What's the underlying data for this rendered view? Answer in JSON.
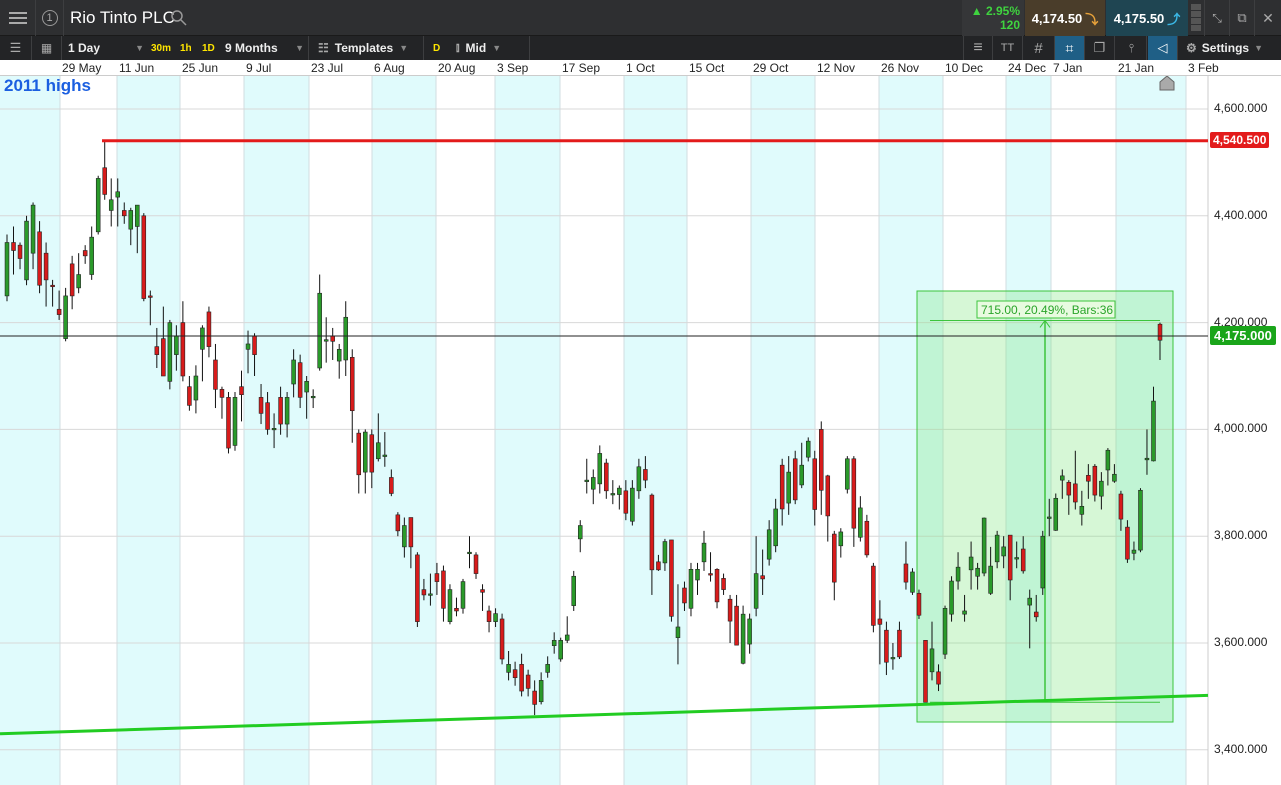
{
  "header": {
    "title": "Rio Tinto PLC",
    "change_pct": "2.95%",
    "change_abs": "120",
    "sell_price": "4,174.50",
    "buy_price": "4,175.50"
  },
  "toolbar": {
    "interval": "1 Day",
    "q30m": "30m",
    "q1h": "1h",
    "q1d": "1D",
    "range": "9 Months",
    "templates": "Templates",
    "d": "D",
    "price_type": "Mid",
    "settings": "Settings",
    "circle_num": "1"
  },
  "chart_annotation": "2011 highs",
  "date_labels": [
    "29 May",
    "11 Jun",
    "25 Jun",
    "9 Jul",
    "23 Jul",
    "6 Aug",
    "20 Aug",
    "3 Sep",
    "17 Sep",
    "1 Oct",
    "15 Oct",
    "29 Oct",
    "12 Nov",
    "26 Nov",
    "10 Dec",
    "24 Dec",
    "7 Jan",
    "21 Jan",
    "3 Feb"
  ],
  "price_labels": [
    "4,600.000",
    "4,400.000",
    "4,200.000",
    "4,000.000",
    "3,800.000",
    "3,600.000",
    "3,400.000"
  ],
  "resistance_label": "4,540.500",
  "current_label": "4,175.000",
  "measure_label": "715.00, 20.49%, Bars:36",
  "colors": {
    "up": "#2a9a2a",
    "down": "#d81b1b",
    "resistance": "#e31b1b",
    "trend": "#22cc22",
    "current": "#1aa51a",
    "band": "#e0fbfc"
  },
  "chart_data": {
    "type": "candlestick",
    "ylim": [
      3380,
      4640
    ],
    "yticks": [
      4600,
      4400,
      4200,
      4000,
      3800,
      3600,
      3400
    ],
    "resistance": 4540.5,
    "current": 4175,
    "trendline": [
      3430,
      3502
    ],
    "measure": {
      "from": 3489,
      "to": 4204,
      "change": 715.0,
      "pct": 20.49,
      "bars": 36
    },
    "candles": [
      [
        4250,
        4365,
        4240,
        4350
      ],
      [
        4350,
        4380,
        4290,
        4335
      ],
      [
        4345,
        4350,
        4300,
        4320
      ],
      [
        4280,
        4400,
        4270,
        4390
      ],
      [
        4330,
        4425,
        4300,
        4420
      ],
      [
        4370,
        4390,
        4255,
        4270
      ],
      [
        4330,
        4350,
        4230,
        4280
      ],
      [
        4270,
        4280,
        4230,
        4268
      ],
      [
        4225,
        4260,
        4205,
        4215
      ],
      [
        4170,
        4265,
        4165,
        4250
      ],
      [
        4310,
        4325,
        4225,
        4250
      ],
      [
        4265,
        4330,
        4255,
        4290
      ],
      [
        4335,
        4345,
        4310,
        4325
      ],
      [
        4290,
        4380,
        4280,
        4360
      ],
      [
        4370,
        4475,
        4365,
        4470
      ],
      [
        4490,
        4540,
        4430,
        4440
      ],
      [
        4410,
        4470,
        4380,
        4430
      ],
      [
        4435,
        4470,
        4380,
        4445
      ],
      [
        4410,
        4425,
        4385,
        4400
      ],
      [
        4375,
        4415,
        4345,
        4410
      ],
      [
        4380,
        4420,
        4330,
        4420
      ],
      [
        4400,
        4405,
        4240,
        4245
      ],
      [
        4250,
        4260,
        4195,
        4248
      ],
      [
        4155,
        4190,
        4115,
        4140
      ],
      [
        4170,
        4230,
        4100,
        4100
      ],
      [
        4090,
        4205,
        4075,
        4200
      ],
      [
        4140,
        4195,
        4110,
        4175
      ],
      [
        4200,
        4240,
        4090,
        4100
      ],
      [
        4080,
        4100,
        4035,
        4045
      ],
      [
        4055,
        4120,
        4030,
        4100
      ],
      [
        4150,
        4195,
        4090,
        4190
      ],
      [
        4220,
        4230,
        4135,
        4155
      ],
      [
        4130,
        4160,
        4040,
        4075
      ],
      [
        4075,
        4080,
        4020,
        4060
      ],
      [
        4060,
        4070,
        3955,
        3965
      ],
      [
        3970,
        4070,
        3960,
        4060
      ],
      [
        4080,
        4110,
        4015,
        4065
      ],
      [
        4150,
        4185,
        4105,
        4160
      ],
      [
        4175,
        4180,
        4100,
        4140
      ],
      [
        4060,
        4085,
        4010,
        4030
      ],
      [
        4050,
        4070,
        3990,
        4000
      ],
      [
        4000,
        4030,
        3965,
        4002
      ],
      [
        4060,
        4080,
        3990,
        4010
      ],
      [
        4010,
        4070,
        3985,
        4060
      ],
      [
        4085,
        4150,
        4060,
        4130
      ],
      [
        4125,
        4140,
        4040,
        4060
      ],
      [
        4070,
        4100,
        4020,
        4090
      ],
      [
        4060,
        4075,
        4040,
        4062
      ],
      [
        4115,
        4290,
        4110,
        4255
      ],
      [
        4167,
        4210,
        4125,
        4168
      ],
      [
        4175,
        4190,
        4130,
        4165
      ],
      [
        4128,
        4160,
        4095,
        4150
      ],
      [
        4130,
        4240,
        4100,
        4210
      ],
      [
        4135,
        4150,
        3975,
        4035
      ],
      [
        3993,
        4000,
        3880,
        3915
      ],
      [
        3920,
        4000,
        3880,
        3995
      ],
      [
        3990,
        4000,
        3890,
        3920
      ],
      [
        3945,
        4030,
        3940,
        3975
      ],
      [
        3950,
        3995,
        3930,
        3952
      ],
      [
        3910,
        3925,
        3875,
        3880
      ],
      [
        3840,
        3845,
        3800,
        3810
      ],
      [
        3780,
        3835,
        3760,
        3820
      ],
      [
        3835,
        3835,
        3740,
        3780
      ],
      [
        3765,
        3770,
        3630,
        3640
      ],
      [
        3700,
        3720,
        3680,
        3690
      ],
      [
        3690,
        3730,
        3670,
        3692
      ],
      [
        3730,
        3750,
        3690,
        3715
      ],
      [
        3735,
        3745,
        3640,
        3665
      ],
      [
        3640,
        3710,
        3635,
        3700
      ],
      [
        3665,
        3685,
        3650,
        3660
      ],
      [
        3665,
        3720,
        3655,
        3715
      ],
      [
        3770,
        3800,
        3740,
        3770
      ],
      [
        3765,
        3770,
        3720,
        3730
      ],
      [
        3700,
        3710,
        3660,
        3695
      ],
      [
        3660,
        3670,
        3620,
        3640
      ],
      [
        3640,
        3665,
        3630,
        3655
      ],
      [
        3645,
        3655,
        3560,
        3570
      ],
      [
        3545,
        3585,
        3530,
        3560
      ],
      [
        3550,
        3565,
        3520,
        3535
      ],
      [
        3560,
        3580,
        3500,
        3510
      ],
      [
        3540,
        3550,
        3500,
        3515
      ],
      [
        3510,
        3530,
        3465,
        3485
      ],
      [
        3490,
        3545,
        3485,
        3530
      ],
      [
        3545,
        3575,
        3535,
        3560
      ],
      [
        3595,
        3620,
        3580,
        3605
      ],
      [
        3570,
        3610,
        3565,
        3605
      ],
      [
        3605,
        3650,
        3600,
        3615
      ],
      [
        3670,
        3735,
        3660,
        3725
      ],
      [
        3795,
        3830,
        3770,
        3820
      ],
      [
        3905,
        3945,
        3880,
        3905
      ],
      [
        3888,
        3925,
        3860,
        3910
      ],
      [
        3898,
        3970,
        3880,
        3955
      ],
      [
        3937,
        3945,
        3870,
        3885
      ],
      [
        3880,
        3905,
        3860,
        3880
      ],
      [
        3878,
        3895,
        3850,
        3890
      ],
      [
        3885,
        3905,
        3830,
        3843
      ],
      [
        3828,
        3905,
        3820,
        3890
      ],
      [
        3885,
        3945,
        3870,
        3930
      ],
      [
        3925,
        3950,
        3890,
        3905
      ],
      [
        3877,
        3880,
        3690,
        3737
      ],
      [
        3752,
        3765,
        3735,
        3737
      ],
      [
        3750,
        3795,
        3735,
        3790
      ],
      [
        3793,
        3793,
        3640,
        3650
      ],
      [
        3610,
        3710,
        3560,
        3630
      ],
      [
        3703,
        3715,
        3660,
        3675
      ],
      [
        3665,
        3750,
        3650,
        3738
      ],
      [
        3718,
        3750,
        3690,
        3738
      ],
      [
        3752,
        3810,
        3735,
        3787
      ],
      [
        3730,
        3770,
        3715,
        3728
      ],
      [
        3738,
        3740,
        3665,
        3677
      ],
      [
        3721,
        3730,
        3690,
        3700
      ],
      [
        3682,
        3690,
        3600,
        3641
      ],
      [
        3669,
        3690,
        3600,
        3596
      ],
      [
        3562,
        3670,
        3560,
        3654
      ],
      [
        3598,
        3655,
        3580,
        3645
      ],
      [
        3665,
        3800,
        3650,
        3730
      ],
      [
        3726,
        3775,
        3690,
        3720
      ],
      [
        3757,
        3830,
        3745,
        3812
      ],
      [
        3782,
        3870,
        3770,
        3851
      ],
      [
        3933,
        3945,
        3820,
        3851
      ],
      [
        3862,
        3950,
        3840,
        3920
      ],
      [
        3945,
        3960,
        3860,
        3868
      ],
      [
        3896,
        3975,
        3890,
        3933
      ],
      [
        3948,
        3985,
        3940,
        3978
      ],
      [
        3945,
        3960,
        3820,
        3850
      ],
      [
        4000,
        4015,
        3840,
        3886
      ],
      [
        3913,
        3915,
        3790,
        3838
      ],
      [
        3804,
        3810,
        3680,
        3714
      ],
      [
        3782,
        3815,
        3760,
        3808
      ],
      [
        3888,
        3950,
        3880,
        3945
      ],
      [
        3945,
        3950,
        3780,
        3815
      ],
      [
        3798,
        3875,
        3790,
        3853
      ],
      [
        3828,
        3840,
        3760,
        3765
      ],
      [
        3744,
        3750,
        3620,
        3633
      ],
      [
        3645,
        3680,
        3560,
        3635
      ],
      [
        3624,
        3640,
        3540,
        3564
      ],
      [
        3573,
        3600,
        3550,
        3573
      ],
      [
        3624,
        3640,
        3570,
        3574
      ],
      [
        3748,
        3790,
        3700,
        3714
      ],
      [
        3695,
        3740,
        3690,
        3733
      ],
      [
        3693,
        3700,
        3645,
        3652
      ],
      [
        3605,
        3605,
        3489,
        3489
      ],
      [
        3546,
        3640,
        3530,
        3589
      ],
      [
        3546,
        3560,
        3510,
        3523
      ],
      [
        3579,
        3670,
        3570,
        3665
      ],
      [
        3654,
        3725,
        3640,
        3716
      ],
      [
        3716,
        3770,
        3700,
        3742
      ],
      [
        3654,
        3690,
        3640,
        3660
      ],
      [
        3737,
        3790,
        3700,
        3761
      ],
      [
        3725,
        3750,
        3700,
        3740
      ],
      [
        3731,
        3835,
        3725,
        3834
      ],
      [
        3693,
        3780,
        3690,
        3744
      ],
      [
        3752,
        3810,
        3740,
        3802
      ],
      [
        3763,
        3800,
        3740,
        3780
      ],
      [
        3802,
        3802,
        3680,
        3718
      ],
      [
        3759,
        3790,
        3740,
        3760
      ],
      [
        3776,
        3800,
        3730,
        3735
      ],
      [
        3671,
        3700,
        3590,
        3684
      ],
      [
        3658,
        3690,
        3640,
        3649
      ],
      [
        3703,
        3810,
        3690,
        3800
      ],
      [
        3834,
        3870,
        3800,
        3836
      ],
      [
        3811,
        3880,
        3810,
        3871
      ],
      [
        3905,
        3925,
        3870,
        3913
      ],
      [
        3901,
        3905,
        3840,
        3877
      ],
      [
        3898,
        3960,
        3850,
        3864
      ],
      [
        3841,
        3885,
        3820,
        3856
      ],
      [
        3914,
        3935,
        3870,
        3903
      ],
      [
        3931,
        3935,
        3865,
        3877
      ],
      [
        3875,
        3920,
        3850,
        3903
      ],
      [
        3924,
        3965,
        3895,
        3961
      ],
      [
        3903,
        3935,
        3900,
        3916
      ],
      [
        3879,
        3885,
        3810,
        3832
      ],
      [
        3817,
        3830,
        3750,
        3757
      ],
      [
        3768,
        3790,
        3755,
        3774
      ],
      [
        3774,
        3890,
        3770,
        3886
      ],
      [
        3943,
        4000,
        3915,
        3946
      ],
      [
        3941,
        4080,
        3940,
        4053
      ],
      [
        4197,
        4200,
        4130,
        4167
      ]
    ]
  }
}
